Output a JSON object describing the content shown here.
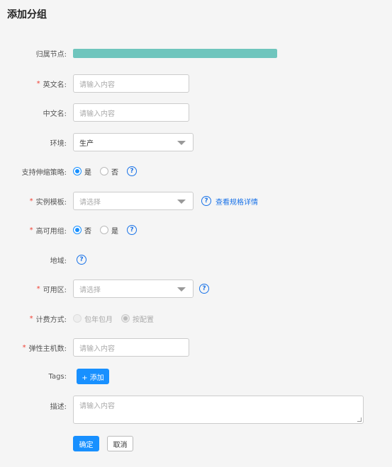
{
  "page": {
    "title": "添加分组"
  },
  "form": {
    "node": {
      "label": "归属节点:",
      "progress": 1.0,
      "fill_color": "#6fc5bd"
    },
    "en_name": {
      "label": "英文名:",
      "required": "*",
      "placeholder": "请输入内容"
    },
    "cn_name": {
      "label": "中文名:",
      "placeholder": "请输入内容"
    },
    "env": {
      "label": "环境:",
      "value": "生产"
    },
    "scaling": {
      "label": "支持伸缩策略:",
      "options": [
        "是",
        "否"
      ],
      "selected": "是",
      "help_icon": "question-circle-icon"
    },
    "template": {
      "label": "实例模板:",
      "required": "*",
      "placeholder": "请选择",
      "link": "查看规格详情"
    },
    "ha": {
      "label": "高可用组:",
      "required": "*",
      "options": [
        "否",
        "是"
      ],
      "selected": "否"
    },
    "region": {
      "label": "地域:"
    },
    "zone": {
      "label": "可用区:",
      "required": "*",
      "placeholder": "请选择"
    },
    "billing": {
      "label": "计费方式:",
      "required": "*",
      "options": [
        "包年包月",
        "按配置"
      ],
      "selected": "按配置",
      "disabled": true
    },
    "hosts": {
      "label": "弹性主机数:",
      "required": "*",
      "placeholder": "请输入内容"
    },
    "tags": {
      "label": "Tags:",
      "add_button": "+ 添加"
    },
    "desc": {
      "label": "描述:",
      "placeholder": "请输入内容"
    }
  },
  "actions": {
    "confirm": "确定",
    "cancel": "取消"
  },
  "colors": {
    "primary": "#1890ff",
    "required": "#f04134",
    "link": "#1a73e8"
  }
}
